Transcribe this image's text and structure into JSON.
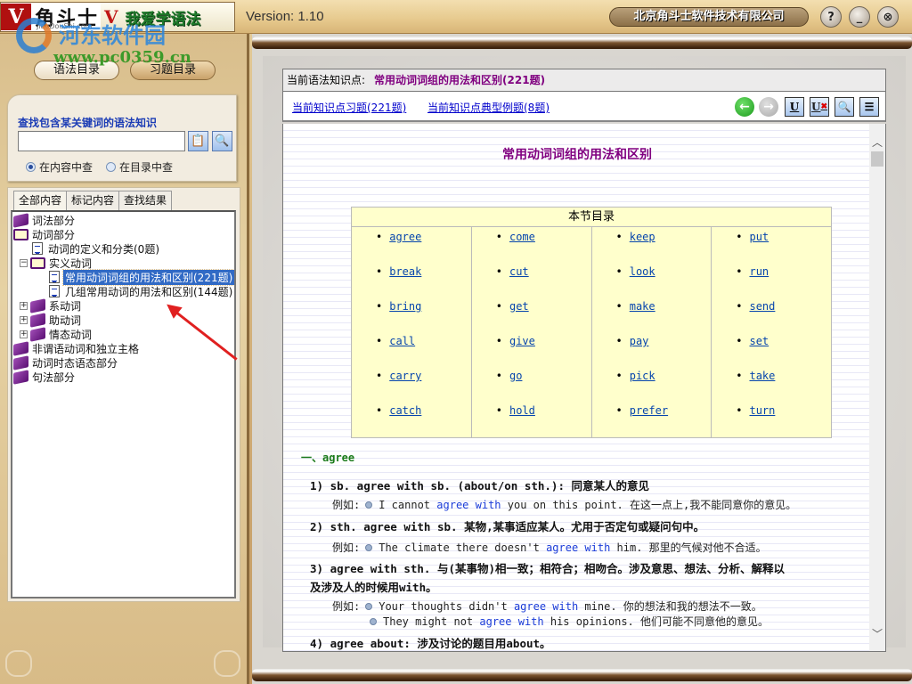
{
  "app": {
    "logo_name": "角斗士",
    "logo_sub": "JiaoDouShi.com",
    "logo_v": "V",
    "slogan": "我爱学语法",
    "version": "Version: 1.10",
    "company": "北京角斗士软件技术有限公司",
    "window_buttons": {
      "help": "?",
      "minimize": "_",
      "close": "⊗"
    }
  },
  "watermark": {
    "text": "河东软件园",
    "url": "www.pc0359.cn"
  },
  "left": {
    "nav": {
      "grammar": "语法目录",
      "exercise": "习题目录"
    },
    "search": {
      "title": "查找包含某关键词的语法知识",
      "input_value": "",
      "radio_content": "在内容中查",
      "radio_toc": "在目录中查",
      "selected": "content"
    },
    "tabs": [
      "全部内容",
      "标记内容",
      "查找结果"
    ],
    "tree": [
      {
        "label": "词法部分",
        "icon": "book",
        "level": 0
      },
      {
        "label": "动词部分",
        "icon": "open-book",
        "level": 0
      },
      {
        "label": "动词的定义和分类(0题)",
        "icon": "doc",
        "level": 1
      },
      {
        "label": "实义动词",
        "icon": "open-book",
        "level": 1,
        "expander": "−"
      },
      {
        "label": "常用动词词组的用法和区别(221题)",
        "icon": "doc",
        "level": 2,
        "selected": true
      },
      {
        "label": "几组常用动词的用法和区别(144题)",
        "icon": "doc",
        "level": 2
      },
      {
        "label": "系动词",
        "icon": "book",
        "level": 1,
        "expander": "+"
      },
      {
        "label": "助动词",
        "icon": "book",
        "level": 1,
        "expander": "+"
      },
      {
        "label": "情态动词",
        "icon": "book",
        "level": 1,
        "expander": "+"
      },
      {
        "label": "非谓语动词和独立主格",
        "icon": "book",
        "level": 0
      },
      {
        "label": "动词时态语态部分",
        "icon": "book",
        "level": 0
      },
      {
        "label": "句法部分",
        "icon": "book",
        "level": 0
      }
    ]
  },
  "right": {
    "kp_label": "当前语法知识点:",
    "kp_value": "常用动词词组的用法和区别(221题)",
    "links": {
      "exercises": "当前知识点习题(221题)",
      "examples": "当前知识点典型例题(8题)"
    },
    "toolbar": {
      "back": "←",
      "forward": "→",
      "underline": "U",
      "remove_underline": "U",
      "find": "🔍",
      "outline": "☰"
    },
    "doc": {
      "title": "常用动词词组的用法和区别",
      "toc_title": "本节目录",
      "toc_columns": [
        [
          "agree",
          "break",
          "bring",
          "call",
          "carry",
          "catch"
        ],
        [
          "come",
          "cut",
          "get",
          "give",
          "go",
          "hold"
        ],
        [
          "keep",
          "look",
          "make",
          "pay",
          "pick",
          "prefer"
        ],
        [
          "put",
          "run",
          "send",
          "set",
          "take",
          "turn"
        ]
      ],
      "section_heading": "一、agree",
      "items": [
        {
          "rule": "1) sb. agree with sb. (about/on sth.): 同意某人的意见",
          "examples": [
            {
              "pre": "I cannot ",
              "kw": "agree with",
              "post": " you on this point. 在这一点上,我不能同意你的意见。"
            }
          ]
        },
        {
          "rule": "2) sth. agree with sb. 某物,某事适应某人。尤用于否定句或疑问句中。",
          "examples": [
            {
              "pre": "The climate there doesn't ",
              "kw": "agree with",
              "post": " him. 那里的气候对他不合适。"
            }
          ]
        },
        {
          "rule": "3) agree with sth. 与(某事物)相一致；相符合；相吻合。涉及意思、想法、分析、解释以",
          "rule_cont": "及涉及人的时候用with。",
          "examples": [
            {
              "pre": "Your thoughts didn't ",
              "kw": "agree with",
              "post": " mine. 你的想法和我的想法不一致。"
            },
            {
              "pre": "They might not ",
              "kw": "agree with",
              "post": " his opinions. 他们可能不同意他的意见。"
            }
          ]
        },
        {
          "rule": "4) agree about: 涉及讨论的题目用about。"
        }
      ],
      "example_label": "例如:"
    }
  }
}
